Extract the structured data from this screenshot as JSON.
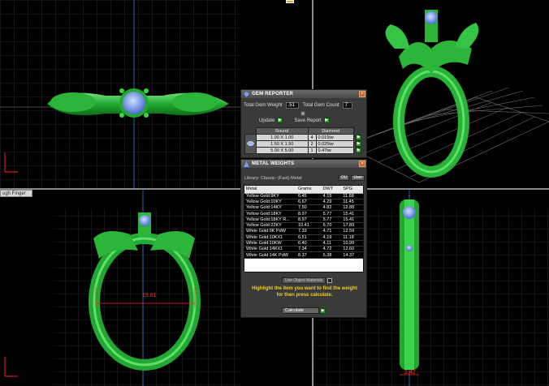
{
  "view_tab": {
    "label": "ugh Finger"
  },
  "gem_reporter": {
    "title": "GEM REPORTER",
    "total_weight_label": "Total Gem Weight",
    "total_weight_value": ".51",
    "total_count_label": "Total Gem Count",
    "total_count_value": "7",
    "update_label": "Update",
    "save_report_label": "Save Report",
    "col_round": "Round",
    "col_diamond": "Diamond",
    "rows": [
      {
        "size": "1.00 X 1.00",
        "count": "4",
        "weight": "0.015tw"
      },
      {
        "size": "1.50 X 1.50",
        "count": "2",
        "weight": "0.025tw"
      },
      {
        "size": "5.00 X 5.00",
        "count": "1",
        "weight": "0.47tw"
      }
    ]
  },
  "metal_weights": {
    "title": "METAL WEIGHTS",
    "library_label": "Library: Classic- (Fast)-Metal",
    "toggle_a": "OU",
    "toggle_b": "User",
    "col_metal": "Metal",
    "col_grams": "Grams",
    "col_dwt": "DWT",
    "col_spg": "SPG",
    "rows": [
      {
        "metal": "Yellow Gold:9KY",
        "grams": "6.45",
        "dwt": "4.15",
        "spg": "11.68"
      },
      {
        "metal": "Yellow Gold:10KY",
        "grams": "6.67",
        "dwt": "4.29",
        "spg": "11.45"
      },
      {
        "metal": "Yellow Gold:14KY",
        "grams": "7.50",
        "dwt": "4.82",
        "spg": "12.88"
      },
      {
        "metal": "Yellow Gold:18KY",
        "grams": "8.97",
        "dwt": "5.77",
        "spg": "15.41"
      },
      {
        "metal": "Yellow Gold:18KY R...",
        "grams": "8.97",
        "dwt": "5.77",
        "spg": "15.41"
      },
      {
        "metal": "Yellow Gold:22KY",
        "grams": "10.41",
        "dwt": "6.70",
        "spg": "17.89"
      },
      {
        "metal": "White Gold:9K PdW",
        "grams": "7.33",
        "dwt": "4.71",
        "spg": "12.59"
      },
      {
        "metal": "White Gold:10KX1",
        "grams": "6.51",
        "dwt": "4.19",
        "spg": "11.18"
      },
      {
        "metal": "White Gold:10KW",
        "grams": "6.40",
        "dwt": "4.11",
        "spg": "10.99"
      },
      {
        "metal": "White Gold:14KX1",
        "grams": "7.34",
        "dwt": "4.72",
        "spg": "12.60"
      },
      {
        "metal": "White Gold:14K PdW",
        "grams": "8.37",
        "dwt": "5.38",
        "spg": "14.37"
      }
    ],
    "use_object_materials": "Use Object Materials",
    "hint_line1": "Highlight the item you want to find the weight",
    "hint_line2": "for then press calculate.",
    "calculate_label": "Calculate"
  },
  "dimensions": {
    "front_diameter": "19.81",
    "side_width": "3.42"
  },
  "colors": {
    "ring": "#2fbf3a",
    "gem": "#7a9ef0",
    "grid": "#4a4a4a",
    "axis_red": "#ff2020"
  }
}
